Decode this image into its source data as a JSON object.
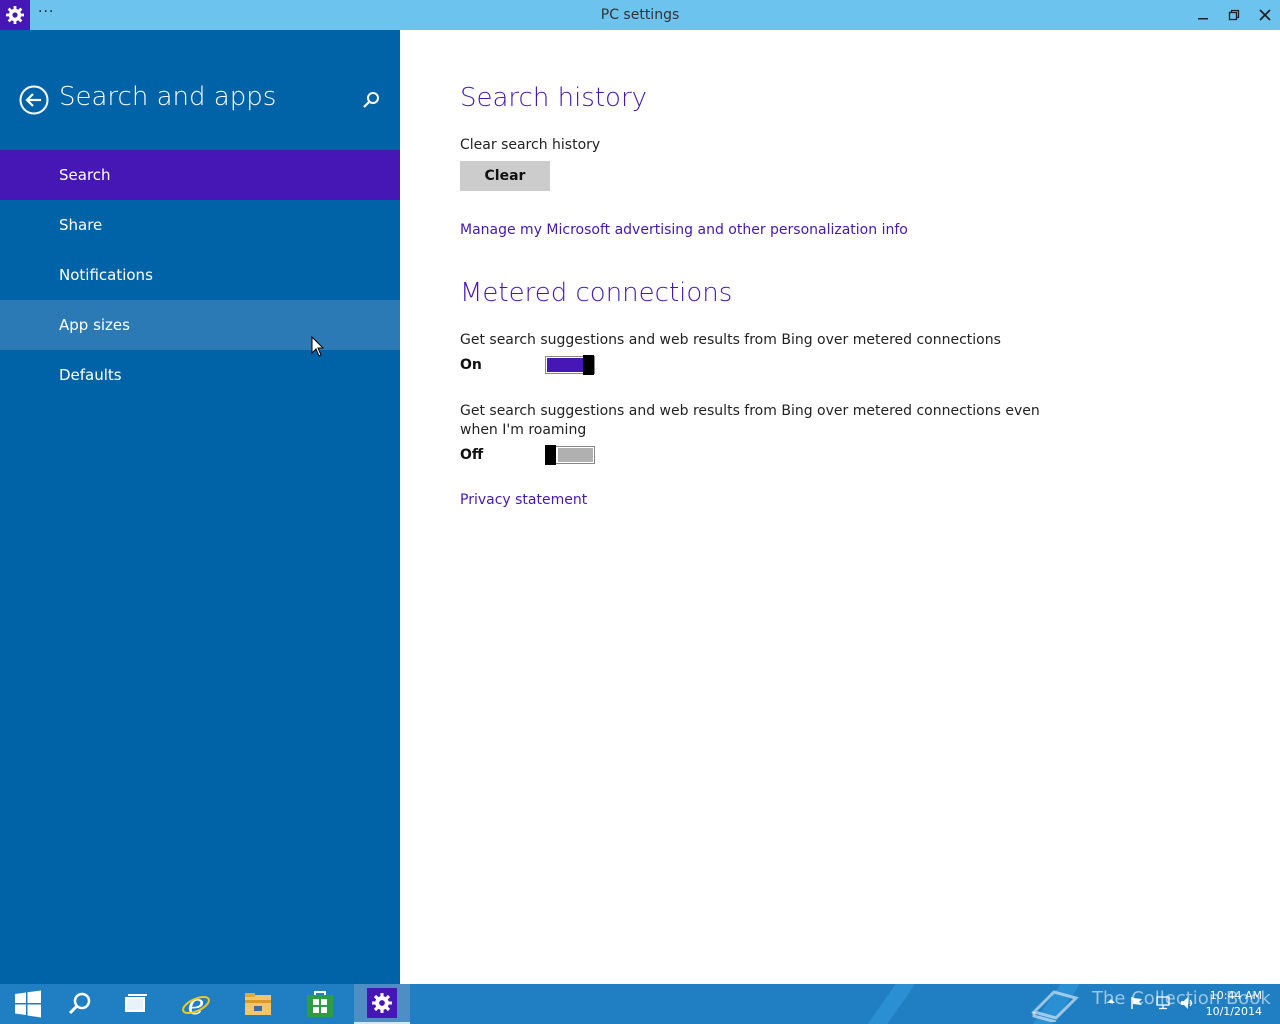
{
  "window": {
    "title": "PC settings",
    "menu_dots": "···"
  },
  "sidebar": {
    "title": "Search and apps",
    "items": [
      {
        "label": "Search"
      },
      {
        "label": "Share"
      },
      {
        "label": "Notifications"
      },
      {
        "label": "App sizes"
      },
      {
        "label": "Defaults"
      }
    ]
  },
  "content": {
    "search_history": {
      "heading": "Search history",
      "clear_label": "Clear search history",
      "clear_button": "Clear",
      "manage_link": "Manage my Microsoft advertising and other personalization info"
    },
    "metered": {
      "heading": "Metered connections",
      "option1": {
        "text": "Get search suggestions and web results from Bing over metered connections",
        "state": "On",
        "on": true
      },
      "option2": {
        "text": "Get search suggestions and web results from Bing over metered connections even when I'm roaming",
        "state": "Off",
        "on": false
      },
      "privacy_link": "Privacy statement"
    }
  },
  "taskbar": {
    "watermark": "The Collection Book",
    "time": "10:44 AM",
    "date": "10/1/2014"
  },
  "colors": {
    "accent": "#4617b4",
    "sidebar": "#0063a8",
    "taskbar": "#1f7fc2",
    "titlebar": "#6cc4ee"
  }
}
